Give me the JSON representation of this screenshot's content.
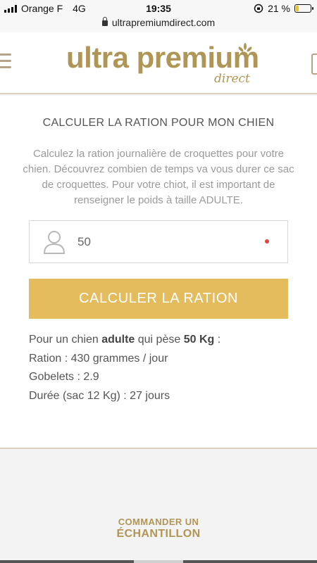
{
  "status_bar": {
    "carrier": "Orange F",
    "network": "4G",
    "time": "19:35",
    "battery_percent": "21 %",
    "battery_level": 0.21
  },
  "browser": {
    "url": "ultrapremiumdirect.com"
  },
  "header": {
    "logo_main": "ultra premium",
    "logo_sub": "direct",
    "brand_color": "#b09656"
  },
  "calculator": {
    "title": "CALCULER LA RATION POUR MON CHIEN",
    "description": "Calculez la ration journalière de croquettes pour votre chien. Découvrez combien de temps va vous durer ce sac de croquettes. Pour votre chiot, il est important de renseigner le poids à taille ADULTE.",
    "weight_value": "50",
    "button_label": "CALCULER LA RATION",
    "button_color": "#e4bc5d"
  },
  "results": {
    "line1_prefix": "Pour un chien ",
    "line1_age": "adulte",
    "line1_mid": " qui pèse ",
    "line1_weight": "50 Kg",
    "line1_suffix": " :",
    "ration": "Ration : 430 grammes / jour",
    "gobelets": "Gobelets : 2.9",
    "duree": "Durée (sac 12 Kg) : 27 jours"
  },
  "footer": {
    "sample_line1": "COMMANDER UN",
    "sample_line2": "ÉCHANTILLON"
  },
  "icons": {
    "menu": "hamburger-menu-icon",
    "cart": "shopping-bag-icon",
    "user": "user-icon",
    "lock": "lock-icon"
  }
}
